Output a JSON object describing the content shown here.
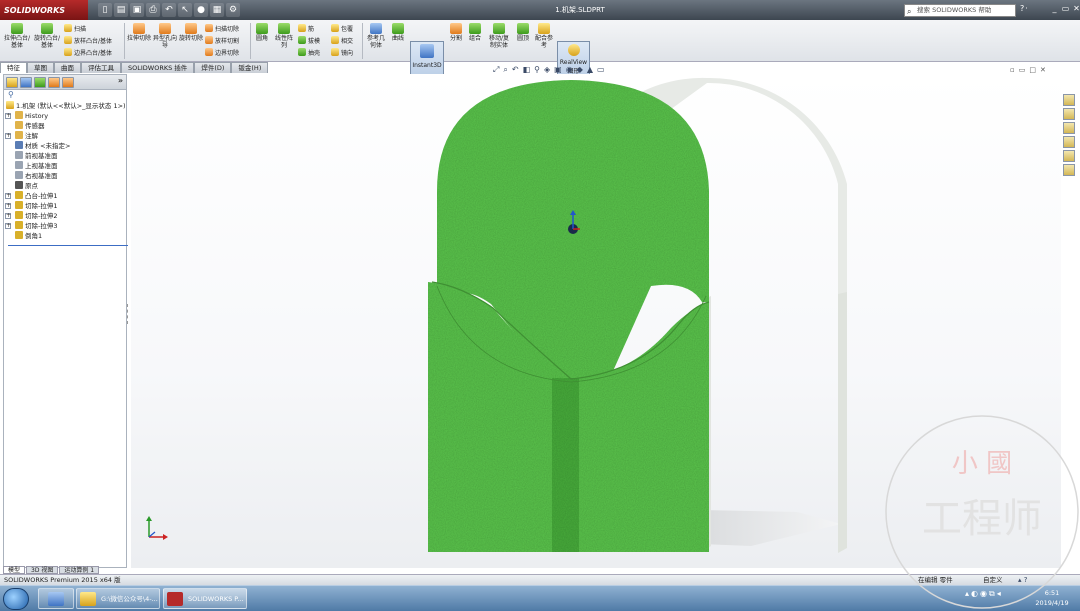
{
  "window": {
    "app_logo": "SOLIDWORKS",
    "title": "1.机架.SLDPRT",
    "search_placeholder": "搜索 SOLIDWORKS 帮助"
  },
  "ribbon": {
    "extruded_boss": "拉伸凸台/基体",
    "revolved_boss": "旋转凸台/基体",
    "sweep": "扫描",
    "loft_boss": "放样凸台/基体",
    "boundary_boss": "边界凸台/基体",
    "extruded_cut": "拉伸切除",
    "hole_wizard": "异型孔向导",
    "revolved_cut": "旋转切除",
    "swept_cut": "扫描切除",
    "lofted_cut": "放样切割",
    "boundary_cut": "边界切除",
    "fillet": "圆角",
    "linear_pattern": "线性阵列",
    "rib": "筋",
    "draft": "拔模",
    "shell": "抽壳",
    "wrap": "包覆",
    "intersect": "相交",
    "mirror": "镜向",
    "reference_geometry": "参考几何体",
    "curves": "曲线",
    "instant3d": "Instant3D",
    "split": "分割",
    "combine": "组合",
    "move_copy": "移动/复制实体",
    "dome": "圆顶",
    "reference": "配合参考",
    "realview": "RealView 图形"
  },
  "tabs": [
    "特征",
    "草图",
    "曲面",
    "评估工具",
    "SOLIDWORKS 插件",
    "焊件(D)",
    "钣金(H)"
  ],
  "feature_tree": {
    "root": "1.机架 (默认<<默认>_显示状态 1>)",
    "items": [
      {
        "label": "History",
        "expandable": true,
        "color": "#e0b34a"
      },
      {
        "label": "传感器",
        "expandable": false,
        "color": "#e0b34a"
      },
      {
        "label": "注解",
        "expandable": true,
        "color": "#e0b34a"
      },
      {
        "label": "材质 <未指定>",
        "expandable": false,
        "color": "#5a7db5"
      },
      {
        "label": "前视基准面",
        "expandable": false,
        "color": "#9aa4b2"
      },
      {
        "label": "上视基准面",
        "expandable": false,
        "color": "#9aa4b2"
      },
      {
        "label": "右视基准面",
        "expandable": false,
        "color": "#9aa4b2"
      },
      {
        "label": "原点",
        "expandable": false,
        "color": "#555555"
      },
      {
        "label": "凸台-拉伸1",
        "expandable": true,
        "color": "#d8b02a"
      },
      {
        "label": "切除-拉伸1",
        "expandable": true,
        "color": "#d8b02a"
      },
      {
        "label": "切除-拉伸2",
        "expandable": true,
        "color": "#d8b02a"
      },
      {
        "label": "切除-拉伸3",
        "expandable": true,
        "color": "#d8b02a"
      },
      {
        "label": "倒角1",
        "expandable": false,
        "color": "#d8b02a"
      }
    ]
  },
  "model_tabs": [
    "模型",
    "3D 视图",
    "运动算例 1"
  ],
  "status": {
    "product": "SOLIDWORKS Premium 2015 x64 版",
    "editing": "在编辑 零件",
    "units": "自定义"
  },
  "taskbar": {
    "window1": "G:\\微信公众号\\4-...",
    "window2": "SOLIDWORKS P...",
    "time": "6:51",
    "date": "2019/4/19"
  },
  "watermark": {
    "top": "小 國",
    "bottom": "工程师"
  },
  "colors": {
    "part_green": "#5bc54d",
    "part_side": "#dfe3dd",
    "accent_red": "#b52a2a"
  }
}
